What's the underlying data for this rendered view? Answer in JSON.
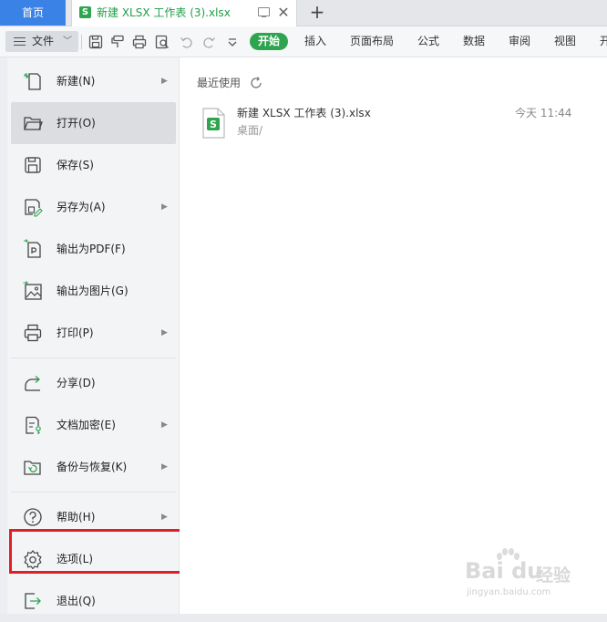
{
  "tabs": {
    "home_label": "首页",
    "doc_title": "新建 XLSX 工作表 (3).xlsx",
    "doc_badge": "S",
    "add_label": "+"
  },
  "toolbar": {
    "file_label": "文件",
    "ribbon": [
      "开始",
      "插入",
      "页面布局",
      "公式",
      "数据",
      "审阅",
      "视图",
      "开"
    ],
    "active_index": 0,
    "quick_icons": [
      "save-icon",
      "format-painter-icon",
      "print-icon",
      "print-preview-icon",
      "undo-icon",
      "redo-icon",
      "more-dropdown-icon"
    ]
  },
  "menu": {
    "items": [
      {
        "label": "新建(N)",
        "icon": "new-file-icon",
        "submenu": true
      },
      {
        "label": "打开(O)",
        "icon": "open-folder-icon",
        "submenu": false
      },
      {
        "label": "保存(S)",
        "icon": "save-icon",
        "submenu": false
      },
      {
        "label": "另存为(A)",
        "icon": "save-as-icon",
        "submenu": true
      },
      {
        "label": "输出为PDF(F)",
        "icon": "export-pdf-icon",
        "submenu": false
      },
      {
        "label": "输出为图片(G)",
        "icon": "export-image-icon",
        "submenu": false
      },
      {
        "label": "打印(P)",
        "icon": "print-icon",
        "submenu": true
      },
      {
        "label": "分享(D)",
        "icon": "share-icon",
        "submenu": false
      },
      {
        "label": "文档加密(E)",
        "icon": "encrypt-icon",
        "submenu": true
      },
      {
        "label": "备份与恢复(K)",
        "icon": "backup-icon",
        "submenu": true
      },
      {
        "label": "帮助(H)",
        "icon": "help-icon",
        "submenu": true
      },
      {
        "label": "选项(L)",
        "icon": "options-gear-icon",
        "submenu": false
      },
      {
        "label": "退出(Q)",
        "icon": "exit-icon",
        "submenu": false
      }
    ],
    "hovered_index": 1,
    "highlighted_index": 11
  },
  "recent": {
    "heading": "最近使用",
    "files": [
      {
        "name": "新建 XLSX 工作表 (3).xlsx",
        "path": "桌面/",
        "time": "今天 11:44"
      }
    ]
  },
  "watermark": {
    "brand": "Bai du",
    "suffix": "经验",
    "url": "jingyan.baidu.com"
  },
  "colors": {
    "accent_green": "#2ea44f",
    "home_tab_blue": "#3b82e6",
    "highlight_red": "#e01e27"
  }
}
